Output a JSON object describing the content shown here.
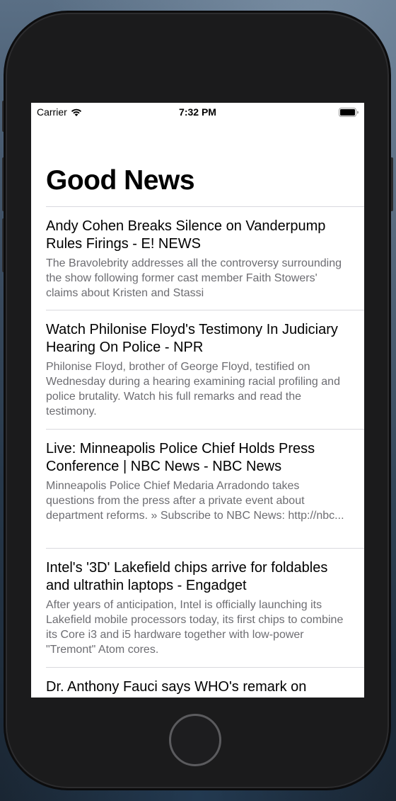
{
  "status_bar": {
    "carrier": "Carrier",
    "time": "7:32 PM"
  },
  "page": {
    "title": "Good News"
  },
  "news": [
    {
      "title": "Andy Cohen Breaks Silence on Vanderpump Rules Firings - E! NEWS",
      "description": "The Bravolebrity addresses all the controversy surrounding the show following former cast member Faith Stowers' claims about Kristen and Stassi"
    },
    {
      "title": "Watch Philonise Floyd's Testimony In Judiciary Hearing On Police - NPR",
      "description": "Philonise Floyd, brother of George Floyd, testified on Wednesday during a hearing examining racial profiling and police brutality. Watch his full remarks and read the testimony."
    },
    {
      "title": "Live: Minneapolis Police Chief Holds Press Conference | NBC News - NBC News",
      "description": "Minneapolis Police Chief Medaria Arradondo takes questions from the press after a private event about department reforms. » Subscribe to NBC News: http://nbc..."
    },
    {
      "title": "Intel's '3D' Lakefield chips arrive for foldables and ultrathin laptops - Engadget",
      "description": "After years of anticipation, Intel is officially launching its Lakefield mobile processors today, its first chips to combine its Core i3 and i5 hardware together with low-power \"Tremont\" Atom cores."
    },
    {
      "title": "Dr. Anthony Fauci says WHO's remark on",
      "description": ""
    }
  ]
}
